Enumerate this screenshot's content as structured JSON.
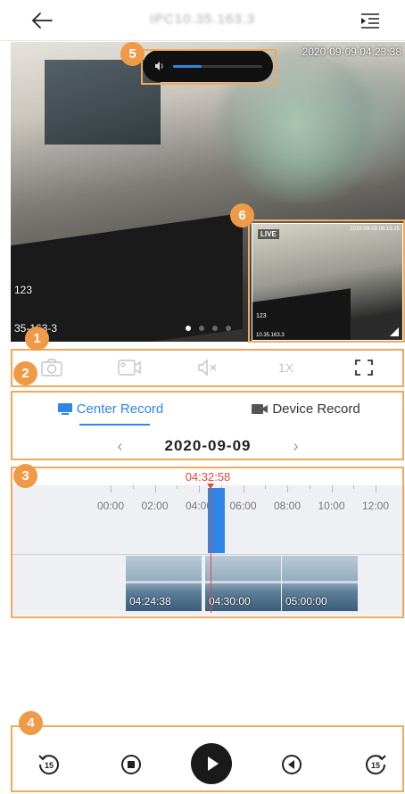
{
  "header": {
    "title": "IPC10.35.163.3",
    "back_icon": "back-arrow-icon",
    "menu_icon": "list-menu-icon"
  },
  "video": {
    "timestamp": "2020-09-09 04:23:38",
    "channel_label": "123",
    "ip_label": "35-163-3",
    "page_count": 4,
    "active_page": 1,
    "volume": {
      "level": 0.32,
      "icon": "speaker-icon"
    },
    "pip": {
      "live_label": "LIVE",
      "timestamp": "2020-09-09 06:15:25",
      "channel_label": "123",
      "ip_label": "10.35.163.3"
    }
  },
  "toolbar": {
    "speed_label": "1X",
    "icons": [
      "camera-icon",
      "record-icon",
      "mute-icon",
      "speed",
      "fullscreen-icon"
    ]
  },
  "record_tabs": {
    "center_label": "Center Record",
    "device_label": "Device Record",
    "active": "center"
  },
  "date_nav": {
    "prev": "‹",
    "date": "2020-09-09",
    "next": "›"
  },
  "timeline": {
    "current_time": "04:32:58",
    "ticks": [
      "00:00",
      "02:00",
      "04:00",
      "06:00",
      "08:00",
      "10:00",
      "12:00"
    ],
    "clips": [
      "04:24:38",
      "04:30:00",
      "05:00:00"
    ]
  },
  "controls": {
    "icons": [
      "rewind-15-icon",
      "stop-icon",
      "play-icon",
      "previous-frame-icon",
      "forward-15-icon"
    ]
  },
  "annotations": [
    "1",
    "2",
    "3",
    "4",
    "5",
    "6"
  ],
  "colors": {
    "accent": "#2f86e6",
    "cursor": "#e8453c",
    "annotation": "#ee9a47"
  }
}
